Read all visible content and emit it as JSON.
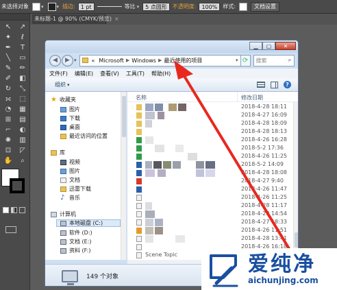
{
  "illustrator": {
    "selection_label": "未选择对象",
    "stroke_label": "描边:",
    "stroke_weight": "1 pt",
    "stroke_profile": "等比",
    "brush": "5 点圆形",
    "opacity_label": "不透明度:",
    "opacity_value": "100%",
    "style_label": "样式:",
    "doc_settings": "文档设置",
    "doc_tab": "未标题-1 @ 90% (CMYK/预览)",
    "tab_close": "×"
  },
  "explorer": {
    "address": [
      "«",
      "Microsoft",
      "Windows",
      "最近使用的项目"
    ],
    "search_placeholder": "搜索",
    "menu": [
      "文件(F)",
      "编辑(E)",
      "查看(V)",
      "工具(T)",
      "帮助(H)"
    ],
    "organize": "组织",
    "nav": {
      "favorites_header": "收藏夹",
      "favorites": [
        "图片",
        "下载",
        "桌面",
        "最近访问的位置"
      ],
      "libraries_header": "库",
      "libraries": [
        "视频",
        "图片",
        "文档",
        "迅雷下载",
        "音乐"
      ],
      "computer_header": "计算机",
      "drives": [
        "本地磁盘 (C:)",
        "软件 (D:)",
        "文档 (E:)",
        "资料 (F:)"
      ]
    },
    "columns": {
      "name": "名称",
      "modified": "修改日期"
    },
    "dates": [
      "2018-4-28 18:11",
      "2018-4-27 16:09",
      "2018-4-28 18:09",
      "2018-4-28 18:13",
      "2018-4-26 16:28",
      "2018-5-2 17:36",
      "2018-4-26 11:25",
      "2018-5-2 14:09",
      "2018-4-28 18:08",
      "2018-4-27 9:40",
      "2018-4-26 11:47",
      "2018-4-26 11:25",
      "2018-4-28 11:17",
      "2018-4-28 14:54",
      "2018-4-27 18:33",
      "2018-4-26 11:51",
      "2018-4-28 13:41",
      "2018-4-26 16:18"
    ],
    "partial_name": "Scene Topic",
    "status": "149 个对象"
  },
  "watermark": {
    "title": "爱纯净",
    "url": "aichunjing.com"
  },
  "colors": {
    "annotation_arrow": "#e8281e",
    "watermark_blue": "#1a4fa0"
  }
}
